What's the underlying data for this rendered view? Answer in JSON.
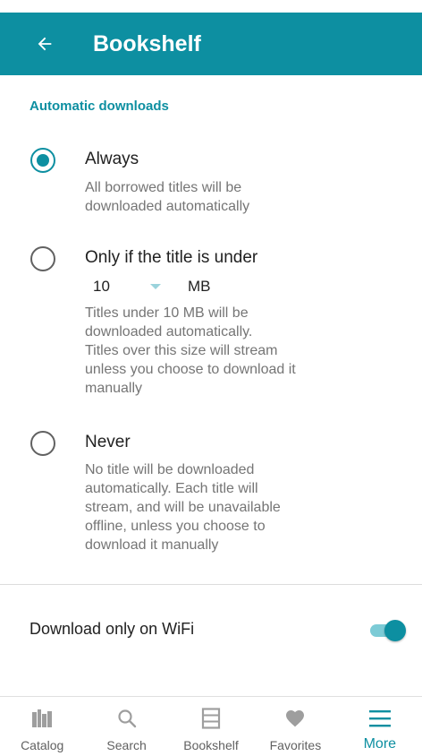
{
  "header": {
    "title": "Bookshelf"
  },
  "section": {
    "label": "Automatic downloads"
  },
  "options": [
    {
      "title": "Always",
      "desc": [
        "All borrowed titles will be",
        "downloaded automatically"
      ],
      "selected": true
    },
    {
      "title": "Only if the title is under",
      "size_value": "10",
      "size_unit": "MB",
      "desc": [
        "Titles under 10 MB will be",
        "downloaded automatically.",
        "Titles over this size will stream",
        "unless you choose to download it",
        "manually"
      ],
      "selected": false
    },
    {
      "title": "Never",
      "desc": [
        "No title will be downloaded",
        "automatically. Each title will",
        "stream, and will be unavailable",
        "offline, unless you choose to",
        "download it manually"
      ],
      "selected": false
    }
  ],
  "wifi": {
    "label": "Download only on WiFi",
    "enabled": true
  },
  "nav": {
    "items": [
      {
        "label": "Catalog",
        "icon": "catalog-icon"
      },
      {
        "label": "Search",
        "icon": "search-icon"
      },
      {
        "label": "Bookshelf",
        "icon": "bookshelf-icon"
      },
      {
        "label": "Favorites",
        "icon": "heart-icon"
      },
      {
        "label": "More",
        "icon": "menu-icon",
        "active": true
      }
    ]
  },
  "colors": {
    "accent": "#0d8fa1",
    "switch_track": "#7ccbd6",
    "muted_text": "#757575",
    "nav_icon": "#9e9e9e"
  }
}
